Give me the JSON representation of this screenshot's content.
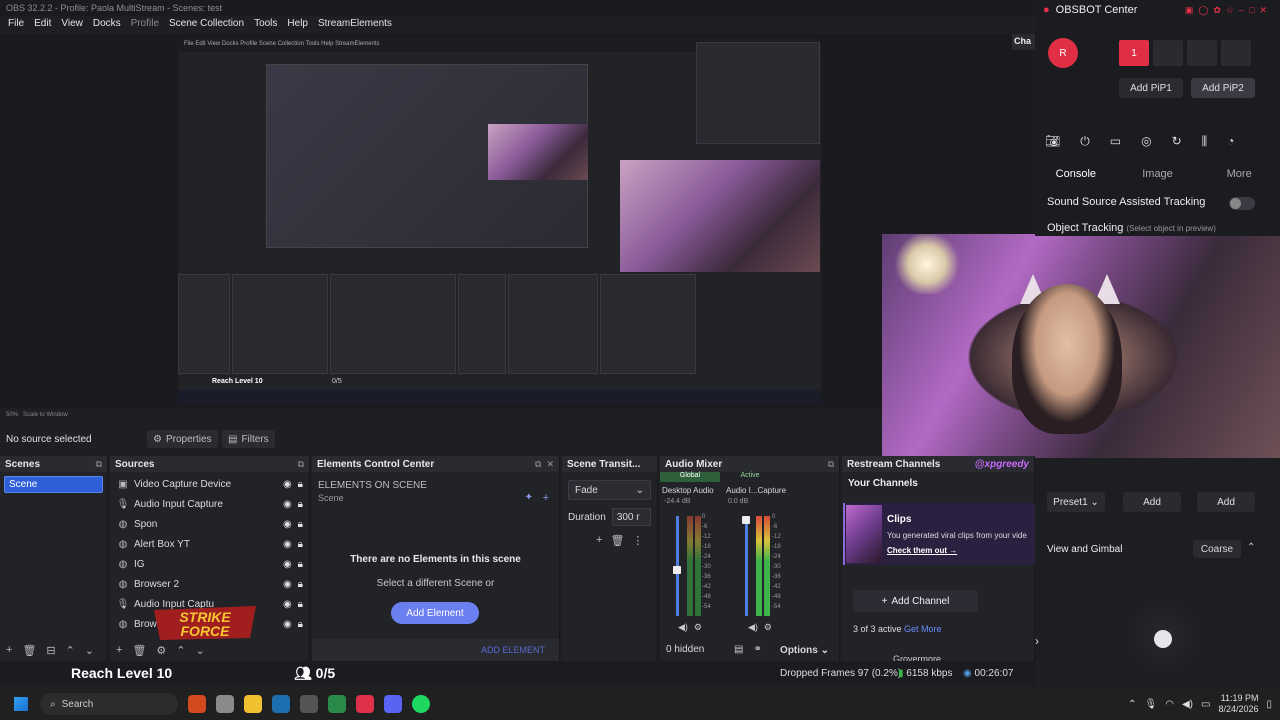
{
  "window": {
    "title": "OBS 32.2.2 - Profile: Paola MultiStream - Scenes: test"
  },
  "menu": {
    "items": [
      "File",
      "Edit",
      "View",
      "Docks",
      "Profile",
      "Scene Collection",
      "Tools",
      "Help",
      "StreamElements"
    ]
  },
  "preview": {
    "nested_menu": "File  Edit  View  Docks  Profile  Scene Collection  Tools  Help  StreamElements",
    "nested_reach": "Reach Level 10",
    "nested_count": "0/5",
    "zoom_label": "50%",
    "scale_label": "Scale to Window"
  },
  "source_status": {
    "no_source": "No source selected",
    "properties": "Properties",
    "filters": "Filters"
  },
  "scenes": {
    "title": "Scenes",
    "items": [
      "Scene"
    ]
  },
  "sources": {
    "title": "Sources",
    "items": [
      {
        "name": "Video Capture Device",
        "icon": "camera-icon"
      },
      {
        "name": "Audio Input Capture",
        "icon": "microphone-icon"
      },
      {
        "name": "Spon",
        "icon": "globe-icon"
      },
      {
        "name": "Alert Box YT",
        "icon": "globe-icon"
      },
      {
        "name": "IG",
        "icon": "globe-icon"
      },
      {
        "name": "Browser 2",
        "icon": "globe-icon"
      },
      {
        "name": "Audio Input Captu",
        "icon": "microphone-icon"
      },
      {
        "name": "Brow",
        "icon": "globe-icon"
      }
    ]
  },
  "elements": {
    "title": "Elements Control Center",
    "on_scene": "ELEMENTS ON SCENE",
    "scene": "Scene",
    "empty": "There are no Elements in this scene",
    "hint": "Select a different Scene or",
    "add_button": "Add Element",
    "toolbar_add": "ADD ELEMENT"
  },
  "transitions": {
    "title": "Scene Transit...",
    "selected": "Fade",
    "duration_label": "Duration",
    "duration_value": "300 r"
  },
  "mixer": {
    "title": "Audio Mixer",
    "tab_global": "Global",
    "tab_active": "Active",
    "ch1_name": "Desktop Audio",
    "ch1_db": "-24.4 dB",
    "ch2_name": "Audio I...Capture",
    "ch2_db": "0.0 dB",
    "scale": [
      "0",
      "-6",
      "-12",
      "-18",
      "-24",
      "-30",
      "-36",
      "-42",
      "-48",
      "-54",
      "-60"
    ],
    "hidden": "0 hidden",
    "options": "Options"
  },
  "restream": {
    "title": "Restream Channels",
    "your_channels": "Your Channels",
    "clips_title": "Clips",
    "clips_desc": "You generated viral clips from your vide",
    "clips_link": "Check them out",
    "add_channel": "Add Channel",
    "active": "3 of 3 active",
    "get_more": "Get More",
    "partial_user": "Grovermore"
  },
  "obsbot": {
    "title": "OBSBOT Center",
    "avatar": "R",
    "slot1": "1",
    "add_pip1": "Add PiP1",
    "add_pip2": "Add PiP2",
    "tabs": [
      "Console",
      "Image",
      "More"
    ],
    "sound_tracking": "Sound Source Assisted Tracking",
    "object_tracking": "Object Tracking",
    "object_tracking_hint": "(Select object in preview)",
    "preset": "Preset1",
    "add1": "Add",
    "add2": "Add",
    "view_gimbal": "View and Gimbal",
    "coarse": "Coarse"
  },
  "status": {
    "reach": "Reach Level 10",
    "count": "0/5",
    "dropped": "Dropped Frames 97 (0.2%)",
    "kbps": "6158 kbps",
    "time": "00:26:07"
  },
  "overlay": {
    "streamer_tag": "@xpgreedy"
  },
  "taskbar": {
    "search": "Search",
    "time": "11:19 PM",
    "date": "8/24/2026"
  }
}
